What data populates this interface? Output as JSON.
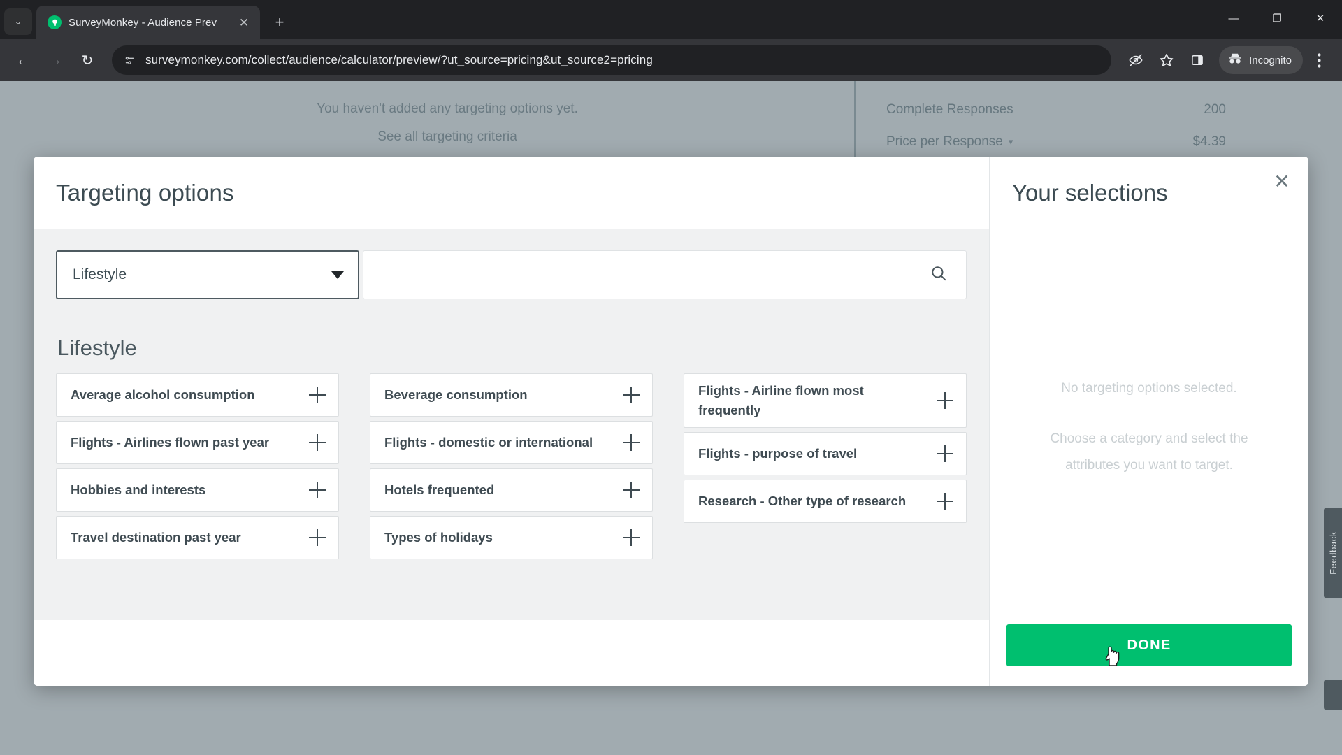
{
  "browser": {
    "tab": {
      "title": "SurveyMonkey - Audience Prev",
      "favicon": "surveymonkey-logo-icon",
      "close": "✕"
    },
    "new_tab_label": "+",
    "tab_list_label": "⌄",
    "window_controls": {
      "minimize": "—",
      "maximize": "❐",
      "close": "✕"
    },
    "nav": {
      "back": "←",
      "forward": "→",
      "reload": "↻"
    },
    "omnibox": {
      "url": "surveymonkey.com/collect/audience/calculator/preview/?ut_source=pricing&ut_source2=pricing",
      "site_icon": "page-info-icon"
    },
    "toolbar_right": {
      "tracking_protection": "eye-slash-icon",
      "bookmark": "star-icon",
      "side_panel": "side-panel-icon",
      "incognito_label": "Incognito",
      "menu": "kebab-menu-icon"
    }
  },
  "background": {
    "empty_line1": "You haven't added any targeting options yet.",
    "empty_link": "See all targeting criteria",
    "summary_rows": [
      {
        "label": "Complete Responses",
        "value": "200",
        "has_chevron": false
      },
      {
        "label": "Price per Response",
        "value": "$4.39",
        "has_chevron": true
      }
    ],
    "feedback_tab_label": "Feedback"
  },
  "modal": {
    "title": "Targeting options",
    "close_label": "✕",
    "category_select": {
      "value": "Lifestyle",
      "caret": "caret-down-icon"
    },
    "search": {
      "value": "",
      "placeholder": "",
      "icon": "search-icon"
    },
    "section_title": "Lifestyle",
    "columns": [
      {
        "items": [
          {
            "label": "Average alcohol consumption",
            "action": "+"
          },
          {
            "label": "Flights - Airlines flown past year",
            "action": "+"
          },
          {
            "label": "Hobbies and interests",
            "action": "+"
          },
          {
            "label": "Travel destination past year",
            "action": "+"
          }
        ]
      },
      {
        "items": [
          {
            "label": "Beverage consumption",
            "action": "+"
          },
          {
            "label": "Flights - domestic or international",
            "action": "+"
          },
          {
            "label": "Hotels frequented",
            "action": "+"
          },
          {
            "label": "Types of holidays",
            "action": "+"
          }
        ]
      },
      {
        "items": [
          {
            "label": "Flights - Airline flown most frequently",
            "action": "+"
          },
          {
            "label": "Flights - purpose of travel",
            "action": "+"
          },
          {
            "label": "Research - Other type of research",
            "action": "+"
          }
        ]
      }
    ],
    "selections": {
      "title": "Your selections",
      "empty_primary": "No targeting options selected.",
      "empty_secondary": "Choose a category and select the attributes you want to target.",
      "done_label": "DONE"
    }
  },
  "colors": {
    "accent_green": "#00bf6f",
    "text_dark": "#3f4b52",
    "modal_body_bg": "#f0f1f2",
    "scrim": "rgba(104,120,128,.62)"
  }
}
